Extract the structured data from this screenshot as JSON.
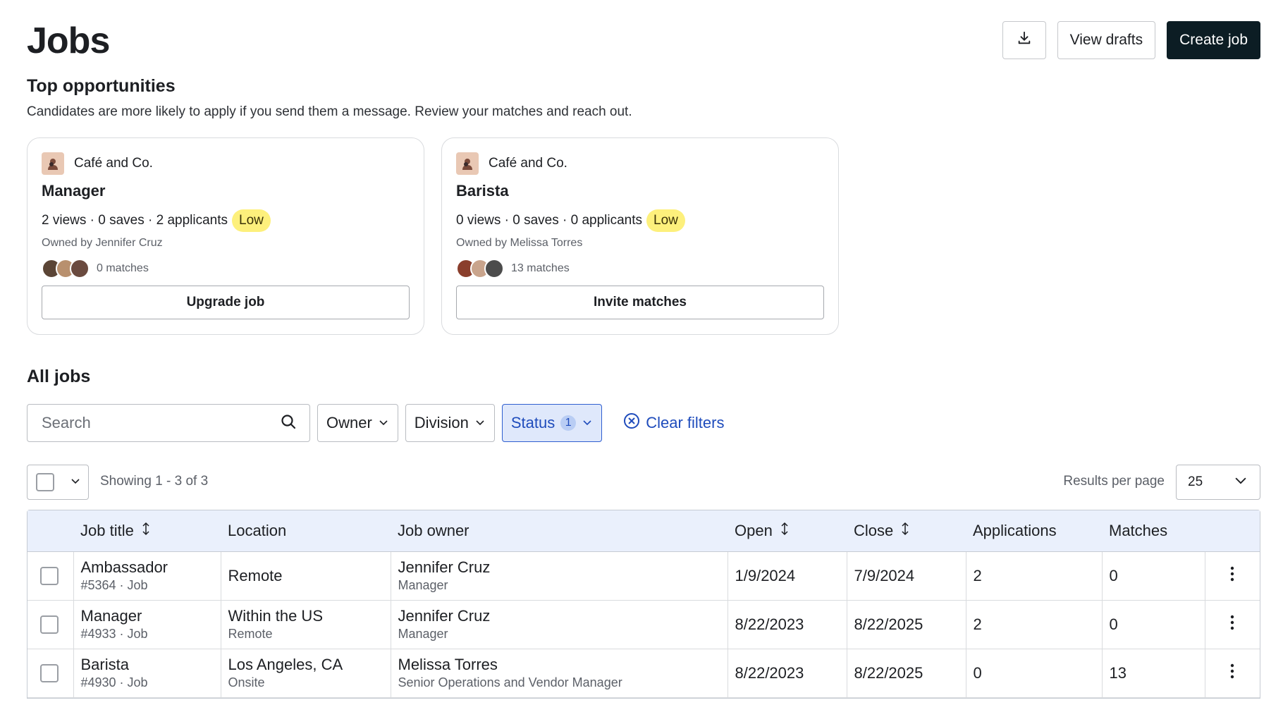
{
  "header": {
    "title": "Jobs",
    "download_icon": "download-icon",
    "view_drafts_label": "View drafts",
    "create_job_label": "Create job"
  },
  "top_opportunities": {
    "title": "Top opportunities",
    "description": "Candidates are more likely to apply if you send them a message. Review your matches and reach out.",
    "cards": [
      {
        "company": "Café and Co.",
        "job_title": "Manager",
        "stats": "2 views · 0 saves · 2 applicants",
        "badge": "Low",
        "owner": "Owned by Jennifer Cruz",
        "matches": "0 matches",
        "action_label": "Upgrade job"
      },
      {
        "company": "Café and Co.",
        "job_title": "Barista",
        "stats": "0 views · 0 saves · 0 applicants",
        "badge": "Low",
        "owner": "Owned by Melissa Torres",
        "matches": "13 matches",
        "action_label": "Invite matches"
      }
    ]
  },
  "all_jobs": {
    "title": "All jobs",
    "search": {
      "placeholder": "Search",
      "value": ""
    },
    "filters": {
      "owner_label": "Owner",
      "division_label": "Division",
      "status_label": "Status",
      "status_count": "1",
      "clear_label": "Clear filters"
    },
    "showing": "Showing 1 - 3 of 3",
    "results_per_page_label": "Results per page",
    "results_per_page_value": "25",
    "columns": {
      "job_title": "Job title",
      "location": "Location",
      "job_owner": "Job owner",
      "open": "Open",
      "close": "Close",
      "applications": "Applications",
      "matches": "Matches"
    },
    "rows": [
      {
        "title": "Ambassador",
        "id": "#5364 · Job",
        "location": "Remote",
        "location_sub": "",
        "owner": "Jennifer Cruz",
        "owner_role": "Manager",
        "open": "1/9/2024",
        "close": "7/9/2024",
        "applications": "2",
        "matches": "0"
      },
      {
        "title": "Manager",
        "id": "#4933 · Job",
        "location": "Within the US",
        "location_sub": "Remote",
        "owner": "Jennifer Cruz",
        "owner_role": "Manager",
        "open": "8/22/2023",
        "close": "8/22/2025",
        "applications": "2",
        "matches": "0"
      },
      {
        "title": "Barista",
        "id": "#4930 · Job",
        "location": "Los Angeles, CA",
        "location_sub": "Onsite",
        "owner": "Melissa Torres",
        "owner_role": "Senior Operations and Vendor Manager",
        "open": "8/22/2023",
        "close": "8/22/2025",
        "applications": "0",
        "matches": "13"
      }
    ]
  },
  "colors": {
    "primary_button": "#0c1d24",
    "low_badge": "#fdf07c",
    "filter_active_bg": "#dfe8fb",
    "link_blue": "#1f4cbc",
    "table_header_bg": "#eaf0fc"
  }
}
